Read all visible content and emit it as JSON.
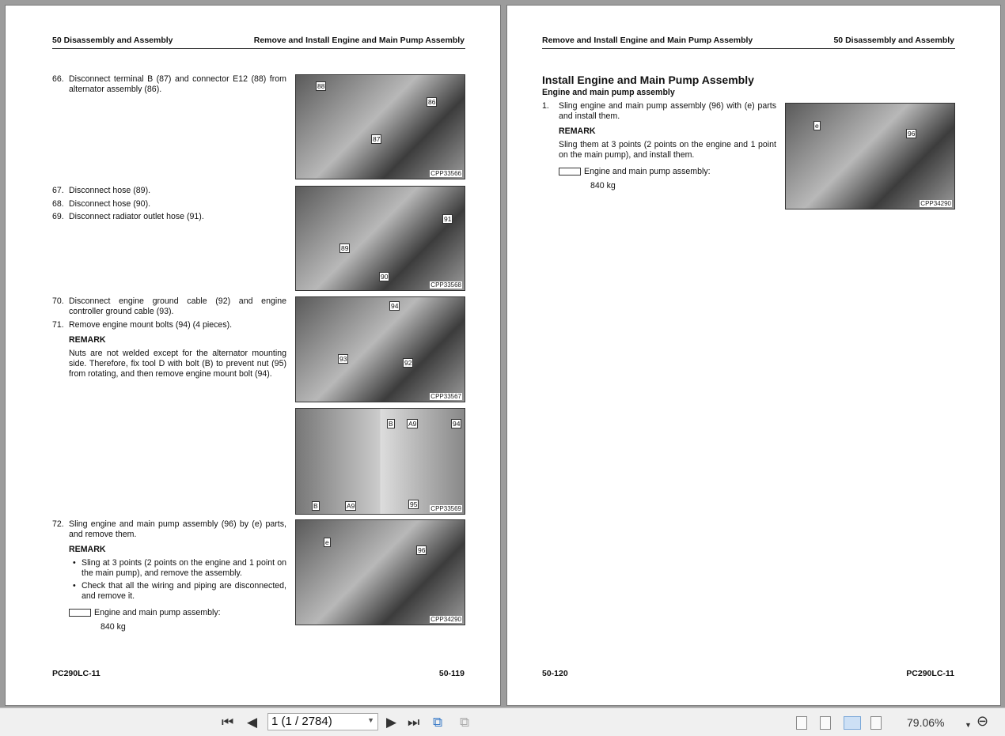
{
  "left_page": {
    "header_left": "50 Disassembly and Assembly",
    "header_right": "Remove and Install Engine and Main Pump Assembly",
    "steps": [
      {
        "num": "66.",
        "text": "Disconnect terminal B (87) and connector E12 (88) from alternator assembly (86)."
      },
      {
        "num": "67.",
        "text": "Disconnect hose (89)."
      },
      {
        "num": "68.",
        "text": "Disconnect hose (90)."
      },
      {
        "num": "69.",
        "text": "Disconnect radiator outlet hose (91)."
      },
      {
        "num": "70.",
        "text": "Disconnect engine ground cable (92) and engine controller ground cable (93)."
      },
      {
        "num": "71.",
        "text": "Remove engine mount bolts (94) (4 pieces)."
      },
      {
        "num": "72.",
        "text": "Sling engine and main pump assembly (96) by (e) parts, and remove them."
      }
    ],
    "remark_label": "REMARK",
    "remark_71": "Nuts are not welded except for the alternator mounting side. Therefore, fix tool D with bolt (B) to prevent nut (95) from rotating, and then remove engine mount bolt (94).",
    "remark_72_bullets": [
      "Sling at 3 points (2 points on the engine and 1 point on the main pump), and remove the assembly.",
      "Check that all the wiring and piping are disconnected, and remove it."
    ],
    "weight_label": "Engine and main pump assembly:",
    "weight_value": "840 kg",
    "figures": [
      {
        "code": "CPP33566",
        "callouts": [
          "88",
          "86",
          "87"
        ]
      },
      {
        "code": "CPP33568",
        "callouts": [
          "91",
          "89",
          "90"
        ]
      },
      {
        "code": "CPP33567",
        "callouts": [
          "94",
          "93",
          "92"
        ]
      },
      {
        "code": "CPP33569",
        "callouts": [
          "B",
          "A9",
          "94",
          "B",
          "A9",
          "95"
        ]
      },
      {
        "code": "CPP34290",
        "callouts": [
          "e",
          "96"
        ]
      }
    ],
    "footer_left": "PC290LC-11",
    "footer_right": "50-119"
  },
  "right_page": {
    "header_left": "Remove and Install Engine and Main Pump Assembly",
    "header_right": "50 Disassembly and Assembly",
    "title": "Install Engine and Main Pump Assembly",
    "subtitle": "Engine and main pump assembly",
    "step_num": "1.",
    "step_text": "Sling engine and main pump assembly (96) with (e) parts and install them.",
    "remark_label": "REMARK",
    "remark_text": "Sling them at 3 points (2 points on the engine and 1 point on the main pump), and install them.",
    "weight_label": "Engine and main pump assembly:",
    "weight_value": "840 kg",
    "figure": {
      "code": "CPP34290",
      "callouts": [
        "e",
        "96"
      ]
    },
    "footer_left": "50-120",
    "footer_right": "PC290LC-11"
  },
  "toolbar": {
    "page_field": "1 (1 / 2784)",
    "zoom": "79.06%"
  }
}
